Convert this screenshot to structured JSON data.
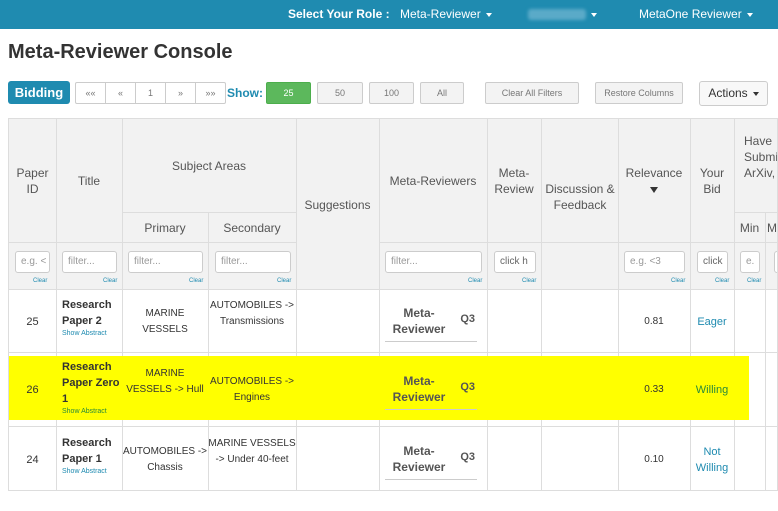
{
  "topbar": {
    "role_label": "Select Your Role :",
    "role_value": "Meta-Reviewer",
    "user_name": "MetaOne Reviewer",
    "background_color": "#1f8bb0"
  },
  "page_title": "Meta-Reviewer Console",
  "toolbar": {
    "bidding": "Bidding",
    "pager": [
      "««",
      "«",
      "1",
      "»",
      "»»"
    ],
    "show_label": "Show:",
    "page_sizes": [
      "25",
      "50",
      "100",
      "All"
    ],
    "active_page_size": "25",
    "clear_filters": "Clear All Filters",
    "restore_columns": "Restore Columns",
    "actions": "Actions"
  },
  "table": {
    "headers": {
      "paper_id": "Paper ID",
      "title": "Title",
      "subject_areas": "Subject Areas",
      "primary": "Primary",
      "secondary": "Secondary",
      "suggestions": "Suggestions",
      "meta_reviewers": "Meta-Reviewers",
      "meta_review": "Meta-Review",
      "discussion": "Discussion & Feedback",
      "relevance": "Relevance",
      "your_bid": "Your Bid",
      "have_submitted": "Have Submi ArXiv, F S",
      "min": "Min",
      "m": "M"
    },
    "filters": {
      "paper_id": "e.g. <",
      "title": "filter...",
      "primary": "filter...",
      "secondary": "filter...",
      "meta_reviewers": "filter...",
      "meta_review": "click h",
      "relevance": "e.g. <3",
      "your_bid": "click",
      "min": "e."
    },
    "clear_label": "Clear",
    "rows": [
      {
        "id": "25",
        "title": "Research Paper 2",
        "show_abstract": "Show Abstract",
        "primary": "MARINE VESSELS",
        "secondary": "AUTOMOBILES -> Transmissions",
        "meta_reviewer": "Meta-Reviewer",
        "quartile": "Q3",
        "relevance": "0.81",
        "bid": "Eager",
        "highlighted": false
      },
      {
        "id": "26",
        "title": "Research Paper Zero 1",
        "show_abstract": "Show Abstract",
        "primary": "MARINE VESSELS -> Hull",
        "secondary": "AUTOMOBILES -> Engines",
        "meta_reviewer": "Meta-Reviewer",
        "quartile": "Q3",
        "relevance": "0.33",
        "bid": "Willing",
        "highlighted": true
      },
      {
        "id": "24",
        "title": "Research Paper 1",
        "show_abstract": "Show Abstract",
        "primary": "AUTOMOBILES -> Chassis",
        "secondary": "MARINE VESSELS -> Under 40-feet",
        "meta_reviewer": "Meta-Reviewer",
        "quartile": "Q3",
        "relevance": "0.10",
        "bid": "Not Willing",
        "highlighted": false
      }
    ]
  }
}
